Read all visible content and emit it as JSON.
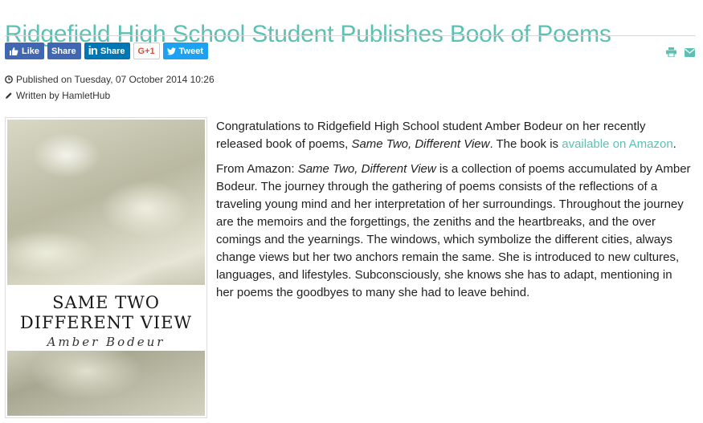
{
  "article": {
    "title": "Ridgefield High School Student Publishes Book of Poems",
    "published": "Published on Tuesday, 07 October 2014 10:26",
    "written_by": "Written by HamletHub"
  },
  "share": {
    "like": "Like",
    "fb_share": "Share",
    "linkedin_share": "Share",
    "gplus": "G+1",
    "tweet": "Tweet"
  },
  "cover": {
    "title_line1": "SAME TWO",
    "title_line2": "DIFFERENT VIEW",
    "author": "Amber Bodeur"
  },
  "body": {
    "p1_a": "Congratulations to Ridgefield High School student Amber Bodeur on her recently released book of poems, ",
    "p1_em": "Same Two, Different View",
    "p1_b": ".   The book is ",
    "p1_link": "available on Amazon",
    "p1_end": ".",
    "p2_a": "From Amazon: ",
    "p2_em": "Same Two, Different View",
    "p2_b": " is a collection of poems accumulated by Amber Bodeur. The journey through the gathering of poems consists of the reflections of a traveling young mind and her interpretation of her surroundings. Throughout the journey are the memoirs and the forgettings, the zeniths and the heartbreaks, and the over comings and the yearnings. The windows, which symbolize the different cities, always change views but her two anchors remain the same. She is introduced to new cultures, languages, and lifestyles. Subconsciously, she knows she has to adapt, mentioning in her poems the goodbyes to many she had to leave behind."
  },
  "colors": {
    "accent": "#5cc1b3",
    "facebook": "#4267b2",
    "linkedin": "#0077b5",
    "twitter": "#1da1f2",
    "gplus": "#dd4b39"
  },
  "icons": [
    "thumbs-up-icon",
    "linkedin-icon",
    "twitter-icon",
    "print-icon",
    "email-icon",
    "clock-icon",
    "pencil-icon"
  ]
}
